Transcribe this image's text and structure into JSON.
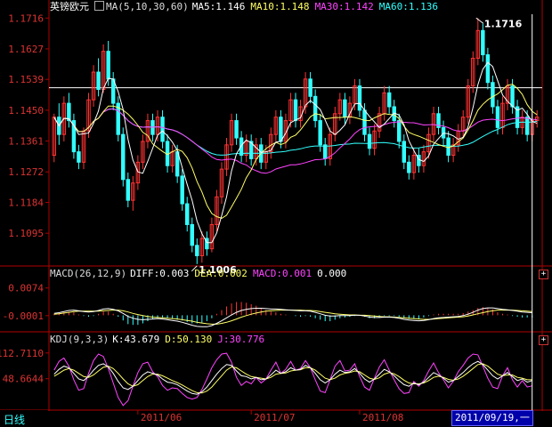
{
  "instrument": "英镑欧元",
  "period_tab": "日线",
  "cursor_date": "2011/09/19,一",
  "colors": {
    "up": "#ff3333",
    "down": "#33ffff",
    "ma5": "#ffffff",
    "ma10": "#ffff66",
    "ma30": "#ff44ff",
    "ma60": "#33ffff",
    "axis": "#b00000",
    "label": "#dd3333",
    "date": "#dd3333",
    "hline": "#ffffff"
  },
  "main_legend": {
    "ma_title": "MA(5,10,30,60)",
    "ma5": "MA5:1.146",
    "ma10": "MA10:1.148",
    "ma30": "MA30:1.142",
    "ma60": "MA60:1.136"
  },
  "macd_legend": {
    "title": "MACD(26,12,9)",
    "diff": "DIFF:0.003",
    "dea": "DEA:0.002",
    "macd": "MACD:0.001",
    "extra": "0.000"
  },
  "kdj_legend": {
    "title": "KDJ(9,3,3)",
    "k": "K:43.679",
    "d": "D:50.130",
    "j": "J:30.776"
  },
  "chart_data": [
    {
      "type": "candlestick",
      "price_ticks": [
        "1.1716",
        "1.1627",
        "1.1539",
        "1.1450",
        "1.1361",
        "1.1272",
        "1.1184",
        "1.1095"
      ],
      "ylim": [
        1.1003,
        1.1727
      ],
      "high_label": "1.1716",
      "low_label": "1.1006",
      "reference_price": 1.1515,
      "x_date_labels": [
        "2011/06",
        "2011/07",
        "2011/08"
      ],
      "x_date_index": [
        17,
        40,
        62
      ],
      "cursor_index": 97,
      "candles": [
        [
          1.132,
          1.143,
          1.144,
          1.13
        ],
        [
          1.143,
          1.138,
          1.147,
          1.135
        ],
        [
          1.138,
          1.147,
          1.149,
          1.136
        ],
        [
          1.147,
          1.142,
          1.15,
          1.14
        ],
        [
          1.142,
          1.133,
          1.144,
          1.131
        ],
        [
          1.133,
          1.13,
          1.135,
          1.128
        ],
        [
          1.13,
          1.139,
          1.14,
          1.128
        ],
        [
          1.139,
          1.148,
          1.15,
          1.137
        ],
        [
          1.148,
          1.156,
          1.158,
          1.146
        ],
        [
          1.156,
          1.151,
          1.16,
          1.149
        ],
        [
          1.151,
          1.162,
          1.164,
          1.15
        ],
        [
          1.162,
          1.154,
          1.165,
          1.152
        ],
        [
          1.154,
          1.147,
          1.156,
          1.145
        ],
        [
          1.147,
          1.138,
          1.149,
          1.136
        ],
        [
          1.138,
          1.125,
          1.14,
          1.123
        ],
        [
          1.125,
          1.119,
          1.127,
          1.117
        ],
        [
          1.119,
          1.124,
          1.126,
          1.116
        ],
        [
          1.124,
          1.13,
          1.132,
          1.122
        ],
        [
          1.13,
          1.136,
          1.138,
          1.128
        ],
        [
          1.136,
          1.142,
          1.144,
          1.134
        ],
        [
          1.142,
          1.138,
          1.144,
          1.136
        ],
        [
          1.138,
          1.143,
          1.145,
          1.136
        ],
        [
          1.143,
          1.136,
          1.145,
          1.134
        ],
        [
          1.136,
          1.129,
          1.138,
          1.127
        ],
        [
          1.129,
          1.133,
          1.135,
          1.127
        ],
        [
          1.133,
          1.126,
          1.135,
          1.124
        ],
        [
          1.126,
          1.118,
          1.128,
          1.116
        ],
        [
          1.118,
          1.112,
          1.12,
          1.11
        ],
        [
          1.112,
          1.106,
          1.114,
          1.104
        ],
        [
          1.106,
          1.103,
          1.108,
          1.1006
        ],
        [
          1.103,
          1.108,
          1.11,
          1.101
        ],
        [
          1.108,
          1.105,
          1.11,
          1.103
        ],
        [
          1.105,
          1.112,
          1.114,
          1.104
        ],
        [
          1.112,
          1.12,
          1.122,
          1.11
        ],
        [
          1.12,
          1.128,
          1.13,
          1.118
        ],
        [
          1.128,
          1.135,
          1.137,
          1.126
        ],
        [
          1.135,
          1.142,
          1.144,
          1.133
        ],
        [
          1.142,
          1.137,
          1.144,
          1.135
        ],
        [
          1.137,
          1.132,
          1.139,
          1.13
        ],
        [
          1.132,
          1.136,
          1.138,
          1.13
        ],
        [
          1.136,
          1.131,
          1.138,
          1.129
        ],
        [
          1.131,
          1.135,
          1.137,
          1.129
        ],
        [
          1.135,
          1.13,
          1.137,
          1.128
        ],
        [
          1.13,
          1.133,
          1.135,
          1.128
        ],
        [
          1.133,
          1.138,
          1.14,
          1.131
        ],
        [
          1.138,
          1.143,
          1.145,
          1.136
        ],
        [
          1.143,
          1.136,
          1.145,
          1.134
        ],
        [
          1.136,
          1.142,
          1.144,
          1.134
        ],
        [
          1.142,
          1.148,
          1.15,
          1.14
        ],
        [
          1.148,
          1.142,
          1.15,
          1.14
        ],
        [
          1.142,
          1.146,
          1.148,
          1.14
        ],
        [
          1.146,
          1.154,
          1.156,
          1.144
        ],
        [
          1.154,
          1.149,
          1.156,
          1.147
        ],
        [
          1.149,
          1.142,
          1.151,
          1.14
        ],
        [
          1.142,
          1.135,
          1.144,
          1.133
        ],
        [
          1.135,
          1.131,
          1.137,
          1.129
        ],
        [
          1.131,
          1.138,
          1.14,
          1.129
        ],
        [
          1.138,
          1.144,
          1.146,
          1.136
        ],
        [
          1.144,
          1.148,
          1.15,
          1.142
        ],
        [
          1.148,
          1.143,
          1.15,
          1.141
        ],
        [
          1.143,
          1.147,
          1.149,
          1.141
        ],
        [
          1.147,
          1.152,
          1.154,
          1.145
        ],
        [
          1.152,
          1.145,
          1.154,
          1.143
        ],
        [
          1.145,
          1.138,
          1.147,
          1.136
        ],
        [
          1.138,
          1.134,
          1.14,
          1.132
        ],
        [
          1.134,
          1.139,
          1.141,
          1.132
        ],
        [
          1.139,
          1.144,
          1.146,
          1.137
        ],
        [
          1.144,
          1.15,
          1.152,
          1.142
        ],
        [
          1.15,
          1.146,
          1.152,
          1.144
        ],
        [
          1.146,
          1.142,
          1.148,
          1.14
        ],
        [
          1.142,
          1.136,
          1.144,
          1.134
        ],
        [
          1.136,
          1.13,
          1.138,
          1.128
        ],
        [
          1.13,
          1.127,
          1.132,
          1.125
        ],
        [
          1.127,
          1.132,
          1.134,
          1.125
        ],
        [
          1.132,
          1.129,
          1.134,
          1.127
        ],
        [
          1.129,
          1.133,
          1.135,
          1.127
        ],
        [
          1.133,
          1.138,
          1.14,
          1.131
        ],
        [
          1.138,
          1.144,
          1.146,
          1.136
        ],
        [
          1.144,
          1.14,
          1.146,
          1.138
        ],
        [
          1.14,
          1.137,
          1.142,
          1.135
        ],
        [
          1.137,
          1.132,
          1.139,
          1.13
        ],
        [
          1.132,
          1.135,
          1.137,
          1.13
        ],
        [
          1.135,
          1.139,
          1.141,
          1.133
        ],
        [
          1.139,
          1.143,
          1.145,
          1.137
        ],
        [
          1.143,
          1.152,
          1.154,
          1.141
        ],
        [
          1.152,
          1.16,
          1.162,
          1.15
        ],
        [
          1.16,
          1.168,
          1.1716,
          1.158
        ],
        [
          1.168,
          1.161,
          1.17,
          1.159
        ],
        [
          1.161,
          1.153,
          1.163,
          1.151
        ],
        [
          1.153,
          1.146,
          1.155,
          1.144
        ],
        [
          1.146,
          1.14,
          1.148,
          1.138
        ],
        [
          1.14,
          1.147,
          1.149,
          1.138
        ],
        [
          1.147,
          1.152,
          1.154,
          1.145
        ],
        [
          1.152,
          1.146,
          1.154,
          1.144
        ],
        [
          1.146,
          1.14,
          1.148,
          1.138
        ],
        [
          1.14,
          1.143,
          1.145,
          1.138
        ],
        [
          1.143,
          1.138,
          1.145,
          1.136
        ],
        [
          1.138,
          1.142,
          1.144,
          1.136
        ],
        [
          1.142,
          1.143,
          1.145,
          1.14
        ]
      ]
    },
    {
      "type": "macd",
      "ticks": [
        "0.0074",
        "-0.0001"
      ],
      "ylim": [
        -0.004,
        0.0095
      ],
      "diff": [
        0.0005,
        0.0007,
        0.001,
        0.0013,
        0.0014,
        0.0012,
        0.001,
        0.0009,
        0.001,
        0.0013,
        0.0017,
        0.0018,
        0.0016,
        0.0012,
        0.0005,
        -0.0003,
        -0.0008,
        -0.0011,
        -0.0012,
        -0.0011,
        -0.001,
        -0.0009,
        -0.001,
        -0.0012,
        -0.0014,
        -0.0016,
        -0.0019,
        -0.0023,
        -0.0027,
        -0.003,
        -0.0031,
        -0.0031,
        -0.0028,
        -0.0022,
        -0.0015,
        -0.0007,
        0.0001,
        0.0008,
        0.0013,
        0.0016,
        0.0018,
        0.0019,
        0.0019,
        0.0018,
        0.0017,
        0.0017,
        0.0016,
        0.0015,
        0.0014,
        0.0013,
        0.0012,
        0.0012,
        0.0011,
        0.0008,
        0.0004,
        0.0,
        -0.0002,
        -0.0002,
        -0.0001,
        -0.0001,
        -0.0001,
        0.0,
        0.0,
        -0.0002,
        -0.0005,
        -0.0006,
        -0.0006,
        -0.0005,
        -0.0005,
        -0.0006,
        -0.0008,
        -0.0011,
        -0.0013,
        -0.0014,
        -0.0015,
        -0.0014,
        -0.0012,
        -0.0009,
        -0.0007,
        -0.0006,
        -0.0005,
        -0.0004,
        -0.0003,
        -0.0001,
        0.0003,
        0.0008,
        0.0014,
        0.0018,
        0.002,
        0.002,
        0.0018,
        0.0016,
        0.0015,
        0.0013,
        0.0011,
        0.0009,
        0.0008,
        0.0007
      ],
      "dea": [
        0.0003,
        0.0004,
        0.0006,
        0.0008,
        0.001,
        0.0011,
        0.0011,
        0.0011,
        0.0011,
        0.0011,
        0.0012,
        0.0013,
        0.0014,
        0.0014,
        0.0012,
        0.0009,
        0.0005,
        0.0002,
        -0.0001,
        -0.0003,
        -0.0005,
        -0.0006,
        -0.0007,
        -0.0008,
        -0.0009,
        -0.001,
        -0.0012,
        -0.0014,
        -0.0016,
        -0.0019,
        -0.0021,
        -0.0023,
        -0.0024,
        -0.0024,
        -0.0022,
        -0.0019,
        -0.0015,
        -0.001,
        -0.0005,
        -0.0001,
        0.0003,
        0.0006,
        0.0009,
        0.0011,
        0.0012,
        0.0013,
        0.0014,
        0.0014,
        0.0014,
        0.0014,
        0.0014,
        0.0013,
        0.0013,
        0.0012,
        0.001,
        0.0008,
        0.0006,
        0.0004,
        0.0003,
        0.0002,
        0.0001,
        0.0001,
        0.0,
        0.0,
        -0.0001,
        -0.0002,
        -0.0003,
        -0.0004,
        -0.0004,
        -0.0005,
        -0.0006,
        -0.0007,
        -0.0008,
        -0.0009,
        -0.001,
        -0.0011,
        -0.0011,
        -0.001,
        -0.0009,
        -0.0008,
        -0.0007,
        -0.0006,
        -0.0005,
        -0.0004,
        -0.0002,
        0.0001,
        0.0004,
        0.0007,
        0.001,
        0.0012,
        0.0014,
        0.0014,
        0.0014,
        0.0014,
        0.0013,
        0.0012,
        0.0011,
        0.001
      ]
    },
    {
      "type": "kdj",
      "ticks": [
        "112.7110",
        "48.6644"
      ],
      "ylim": [
        -25,
        130
      ],
      "k": [
        60,
        72,
        80,
        76,
        62,
        48,
        44,
        55,
        70,
        82,
        86,
        78,
        62,
        42,
        26,
        22,
        30,
        44,
        58,
        66,
        62,
        58,
        48,
        40,
        38,
        34,
        26,
        18,
        12,
        10,
        16,
        28,
        44,
        60,
        74,
        84,
        82,
        68,
        56,
        54,
        48,
        52,
        46,
        48,
        58,
        70,
        62,
        66,
        76,
        70,
        72,
        82,
        76,
        62,
        46,
        38,
        46,
        60,
        70,
        64,
        66,
        74,
        62,
        48,
        40,
        48,
        60,
        72,
        66,
        56,
        44,
        34,
        30,
        38,
        34,
        40,
        52,
        64,
        58,
        50,
        40,
        44,
        54,
        64,
        76,
        86,
        92,
        84,
        70,
        56,
        48,
        56,
        64,
        54,
        44,
        48,
        40,
        44
      ],
      "d": [
        55,
        62,
        70,
        74,
        70,
        62,
        54,
        52,
        58,
        68,
        77,
        80,
        74,
        62,
        48,
        36,
        30,
        34,
        44,
        54,
        60,
        60,
        56,
        50,
        44,
        39,
        33,
        26,
        19,
        14,
        13,
        18,
        28,
        42,
        56,
        70,
        78,
        76,
        68,
        60,
        54,
        52,
        50,
        48,
        52,
        60,
        62,
        63,
        68,
        70,
        71,
        76,
        76,
        70,
        60,
        50,
        46,
        50,
        58,
        62,
        64,
        68,
        66,
        58,
        50,
        47,
        51,
        60,
        64,
        61,
        54,
        45,
        38,
        36,
        36,
        38,
        44,
        52,
        55,
        52,
        47,
        45,
        48,
        55,
        64,
        74,
        84,
        86,
        80,
        70,
        60,
        56,
        58,
        58,
        52,
        50,
        46,
        46
      ],
      "j": [
        70,
        92,
        100,
        80,
        46,
        20,
        24,
        62,
        94,
        110,
        104,
        74,
        38,
        2,
        -18,
        -6,
        30,
        64,
        86,
        90,
        66,
        54,
        32,
        20,
        26,
        24,
        12,
        2,
        -2,
        2,
        22,
        48,
        76,
        96,
        110,
        112,
        90,
        52,
        32,
        42,
        36,
        52,
        38,
        48,
        70,
        90,
        62,
        72,
        92,
        70,
        74,
        94,
        76,
        46,
        18,
        14,
        46,
        80,
        94,
        68,
        70,
        86,
        54,
        28,
        20,
        50,
        78,
        96,
        70,
        46,
        24,
        12,
        14,
        42,
        30,
        44,
        68,
        88,
        64,
        46,
        26,
        42,
        66,
        82,
        100,
        110,
        108,
        80,
        50,
        28,
        24,
        56,
        76,
        46,
        28,
        44,
        28,
        31
      ]
    }
  ]
}
